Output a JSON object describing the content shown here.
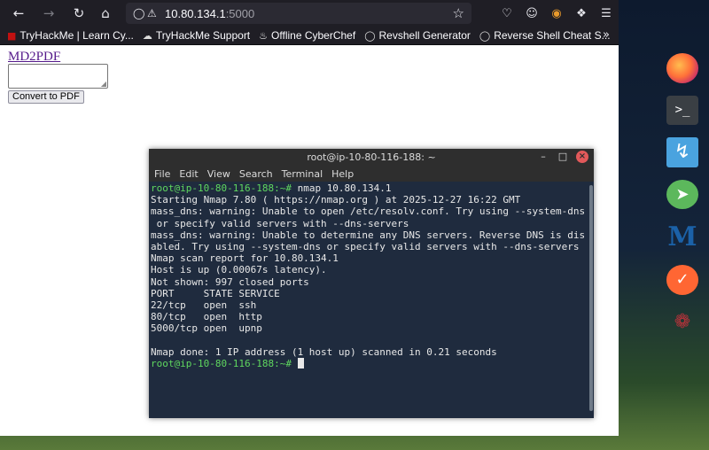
{
  "browser": {
    "url_host": "10.80.134.1",
    "url_port": ":5000",
    "bookmarks": [
      {
        "label": "TryHackMe | Learn Cy..."
      },
      {
        "label": "TryHackMe Support"
      },
      {
        "label": "Offline CyberChef"
      },
      {
        "label": "Revshell Generator"
      },
      {
        "label": "Reverse Shell Cheat S..."
      }
    ]
  },
  "page": {
    "link": "MD2PDF",
    "button": "Convert to PDF"
  },
  "terminal": {
    "title": "root@ip-10-80-116-188: ~",
    "menu": [
      "File",
      "Edit",
      "View",
      "Search",
      "Terminal",
      "Help"
    ],
    "prompt1": "root@ip-10-80-116-188:~#",
    "command1": " nmap 10.80.134.1",
    "lines": [
      "Starting Nmap 7.80 ( https://nmap.org ) at 2025-12-27 16:22 GMT",
      "mass_dns: warning: Unable to open /etc/resolv.conf. Try using --system-dns",
      " or specify valid servers with --dns-servers",
      "mass_dns: warning: Unable to determine any DNS servers. Reverse DNS is dis",
      "abled. Try using --system-dns or specify valid servers with --dns-servers",
      "Nmap scan report for 10.80.134.1",
      "Host is up (0.00067s latency).",
      "Not shown: 997 closed ports",
      "PORT     STATE SERVICE",
      "22/tcp   open  ssh",
      "80/tcp   open  http",
      "5000/tcp open  upnp",
      "",
      "Nmap done: 1 IP address (1 host up) scanned in 0.21 seconds"
    ],
    "prompt2": "root@ip-10-80-116-188:~#",
    "command2": " "
  }
}
